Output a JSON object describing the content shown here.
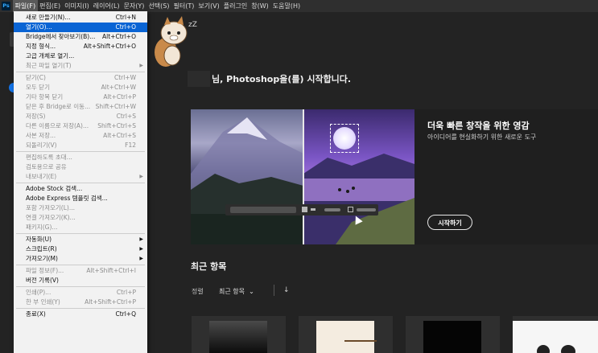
{
  "app": {
    "logo": "Ps"
  },
  "menubar": [
    {
      "label": "파일(F)",
      "active": true
    },
    {
      "label": "편집(E)"
    },
    {
      "label": "이미지(I)"
    },
    {
      "label": "레이어(L)"
    },
    {
      "label": "문자(Y)"
    },
    {
      "label": "선택(S)"
    },
    {
      "label": "필터(T)"
    },
    {
      "label": "보기(V)"
    },
    {
      "label": "플러그인"
    },
    {
      "label": "창(W)"
    },
    {
      "label": "도움말(H)"
    }
  ],
  "file_menu": {
    "items": [
      {
        "label": "새로 만들기(N)...",
        "shortcut": "Ctrl+N"
      },
      {
        "label": "열기(O)...",
        "shortcut": "Ctrl+O",
        "highlighted": true
      },
      {
        "label": "Bridge에서 찾아보기(B)...",
        "shortcut": "Alt+Ctrl+O"
      },
      {
        "label": "지정 형식...",
        "shortcut": "Alt+Shift+Ctrl+O"
      },
      {
        "label": "고급 개체로 열기..."
      },
      {
        "label": "최근 파일 열기(T)",
        "submenu": true,
        "disabled": true
      },
      {
        "separator": true
      },
      {
        "label": "닫기(C)",
        "shortcut": "Ctrl+W",
        "disabled": true
      },
      {
        "label": "모두 닫기",
        "shortcut": "Alt+Ctrl+W",
        "disabled": true
      },
      {
        "label": "기타 항목 닫기",
        "shortcut": "Alt+Ctrl+P",
        "disabled": true
      },
      {
        "label": "닫은 후 Bridge로 이동...",
        "shortcut": "Shift+Ctrl+W",
        "disabled": true
      },
      {
        "label": "저장(S)",
        "shortcut": "Ctrl+S",
        "disabled": true
      },
      {
        "label": "다른 이름으로 저장(A)...",
        "shortcut": "Shift+Ctrl+S",
        "disabled": true
      },
      {
        "label": "사본 저장...",
        "shortcut": "Alt+Ctrl+S",
        "disabled": true
      },
      {
        "label": "되돌리기(V)",
        "shortcut": "F12",
        "disabled": true
      },
      {
        "separator": true
      },
      {
        "label": "편집하도록 초대...",
        "disabled": true
      },
      {
        "label": "검토용으로 공유",
        "disabled": true
      },
      {
        "label": "내보내기(E)",
        "submenu": true,
        "disabled": true
      },
      {
        "separator": true
      },
      {
        "label": "Adobe Stock 검색..."
      },
      {
        "label": "Adobe Express 템플릿 검색..."
      },
      {
        "label": "포함 가져오기(L)...",
        "disabled": true
      },
      {
        "label": "연결 가져오기(K)...",
        "disabled": true
      },
      {
        "label": "패키지(G)...",
        "disabled": true
      },
      {
        "separator": true
      },
      {
        "label": "자동화(U)",
        "submenu": true
      },
      {
        "label": "스크립트(R)",
        "submenu": true
      },
      {
        "label": "가져오기(M)",
        "submenu": true
      },
      {
        "separator": true
      },
      {
        "label": "파일 정보(F)...",
        "shortcut": "Alt+Shift+Ctrl+I",
        "disabled": true
      },
      {
        "label": "버전 기록(V)"
      },
      {
        "separator": true
      },
      {
        "label": "인쇄(P)...",
        "shortcut": "Ctrl+P",
        "disabled": true
      },
      {
        "label": "한 부 인쇄(Y)",
        "shortcut": "Alt+Shift+Ctrl+P",
        "disabled": true
      },
      {
        "separator": true
      },
      {
        "label": "종료(X)",
        "shortcut": "Ctrl+Q"
      }
    ]
  },
  "home": {
    "greeting": "님, Photoshop을(를) 시작합니다.",
    "hero": {
      "title": "더욱 빠른 창작을 위한 영감",
      "subtitle": "아이디어를 현실화하기 위한 새로운 도구",
      "button": "시작하기"
    },
    "recent": {
      "title": "최근 항목",
      "sort_label": "정렬",
      "sort_value": "최근 항목",
      "sort_arrow": "↓"
    }
  },
  "mascot": {
    "caption": "zZ"
  },
  "colors": {
    "menu_highlight": "#0a64d4",
    "app_bg": "#232323",
    "menu_bg": "#f2f2f2"
  }
}
